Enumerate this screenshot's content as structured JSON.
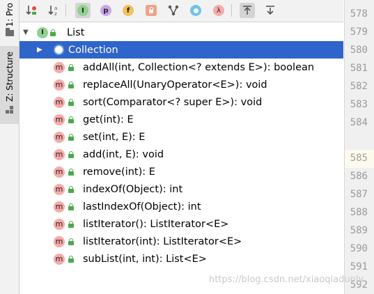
{
  "side_tabs": {
    "project": "1: Pro",
    "structure": "Z: Structure"
  },
  "toolbar": {
    "buttons": [
      {
        "name": "sort-by-visibility",
        "icon": "sort-visibility-icon"
      },
      {
        "name": "sort-alphabetically",
        "icon": "sort-alpha-icon"
      },
      {
        "name": "show-inherited",
        "icon": "inherited-icon",
        "glyph": "I"
      },
      {
        "name": "show-properties",
        "icon": "property-icon",
        "glyph": "p"
      },
      {
        "name": "show-fields",
        "icon": "field-icon",
        "glyph": "f"
      },
      {
        "name": "show-non-public",
        "icon": "lock-icon"
      },
      {
        "name": "show-interfaces-tree",
        "icon": "hierarchy-icon"
      },
      {
        "name": "show-anonymous",
        "icon": "anonymous-icon"
      },
      {
        "name": "show-lambdas",
        "icon": "lambda-icon",
        "glyph": "λ"
      },
      {
        "name": "autoscroll-to-source",
        "icon": "autoscroll-to-icon"
      },
      {
        "name": "autoscroll-from-source",
        "icon": "autoscroll-from-icon"
      }
    ]
  },
  "tree": {
    "root": {
      "label": "List",
      "icon_glyph": "I"
    },
    "selected": {
      "label": "Collection"
    },
    "methods": [
      "addAll(int, Collection<? extends E>): boolean",
      "replaceAll(UnaryOperator<E>): void",
      "sort(Comparator<? super E>): void",
      "get(int): E",
      "set(int, E): E",
      "add(int, E): void",
      "remove(int): E",
      "indexOf(Object): int",
      "lastIndexOf(Object): int",
      "listIterator(): ListIterator<E>",
      "listIterator(int): ListIterator<E>",
      "subList(int, int): List<E>"
    ],
    "method_icon_glyph": "m"
  },
  "gutter": {
    "lines": [
      "578",
      "579",
      "580",
      "581",
      "582",
      "583",
      "584",
      "585",
      "586",
      "587",
      "588",
      "589",
      "590",
      "591",
      "592"
    ]
  },
  "watermark": "https://blog.csdn.net/xiaoqiadunly",
  "colors": {
    "selection": "#2f65ca",
    "method_icon": "#f6aaaa",
    "interface_icon": "#8fd18f",
    "lock": "#4ca84c"
  }
}
